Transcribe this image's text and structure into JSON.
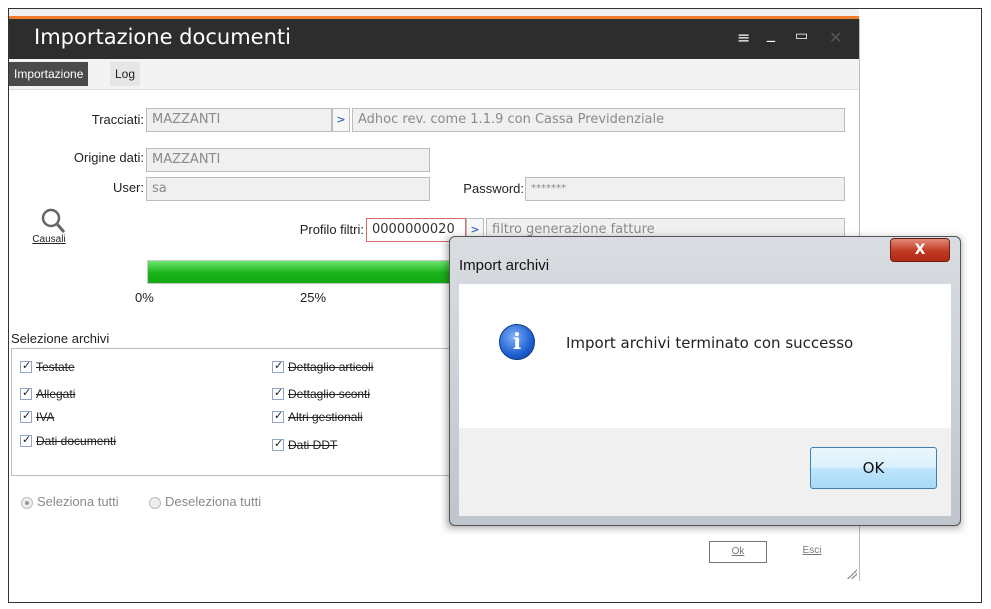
{
  "window": {
    "title": "Importazione documenti",
    "controls": {
      "menu": "≡",
      "minimize": "_",
      "maximize": "▭",
      "close": "✕"
    }
  },
  "tabs": [
    {
      "label": "Importazione",
      "active": true
    },
    {
      "label": "Log",
      "active": false
    }
  ],
  "form": {
    "tracciati_label": "Tracciati:",
    "tracciati_value": "MAZZANTI",
    "tracciati_desc": "Adhoc rev. come 1.1.9 con Cassa Previdenziale",
    "origine_label": "Origine dati:",
    "origine_value": "MAZZANTI",
    "user_label": "User:",
    "user_value": "sa",
    "password_label": "Password:",
    "password_value": "*******",
    "profilo_label": "Profilo filtri:",
    "profilo_value": "0000000020",
    "profilo_desc": "filtro generazione fatture",
    "causali_label": "Causali"
  },
  "progress": {
    "value_percent": 100,
    "ticks": [
      "0%",
      "25%"
    ]
  },
  "selezione": {
    "label": "Selezione archivi",
    "items": [
      {
        "label": "Testate",
        "checked": true
      },
      {
        "label": "Dettaglio articoli",
        "checked": true
      },
      {
        "label": "Allegati",
        "checked": true
      },
      {
        "label": "Dettaglio sconti",
        "checked": true
      },
      {
        "label": "IVA",
        "checked": true
      },
      {
        "label": "Altri gestionali",
        "checked": true
      },
      {
        "label": "Dati documenti",
        "checked": true
      },
      {
        "label": "Dati DDT",
        "checked": true
      }
    ]
  },
  "radios": {
    "select_all": "Seleziona tutti",
    "deselect_all": "Deseleziona tutti"
  },
  "under_buttons": {
    "ok": "Ok",
    "exit": "Esci"
  },
  "dialog": {
    "title": "Import archivi",
    "message": "Import archivi terminato con successo",
    "ok_label": "OK",
    "close_glyph": "X",
    "info_glyph": "i"
  },
  "colors": {
    "accent_orange": "#f07c2a",
    "titlebar": "#2d2d2d",
    "progress_green": "#19b319"
  }
}
